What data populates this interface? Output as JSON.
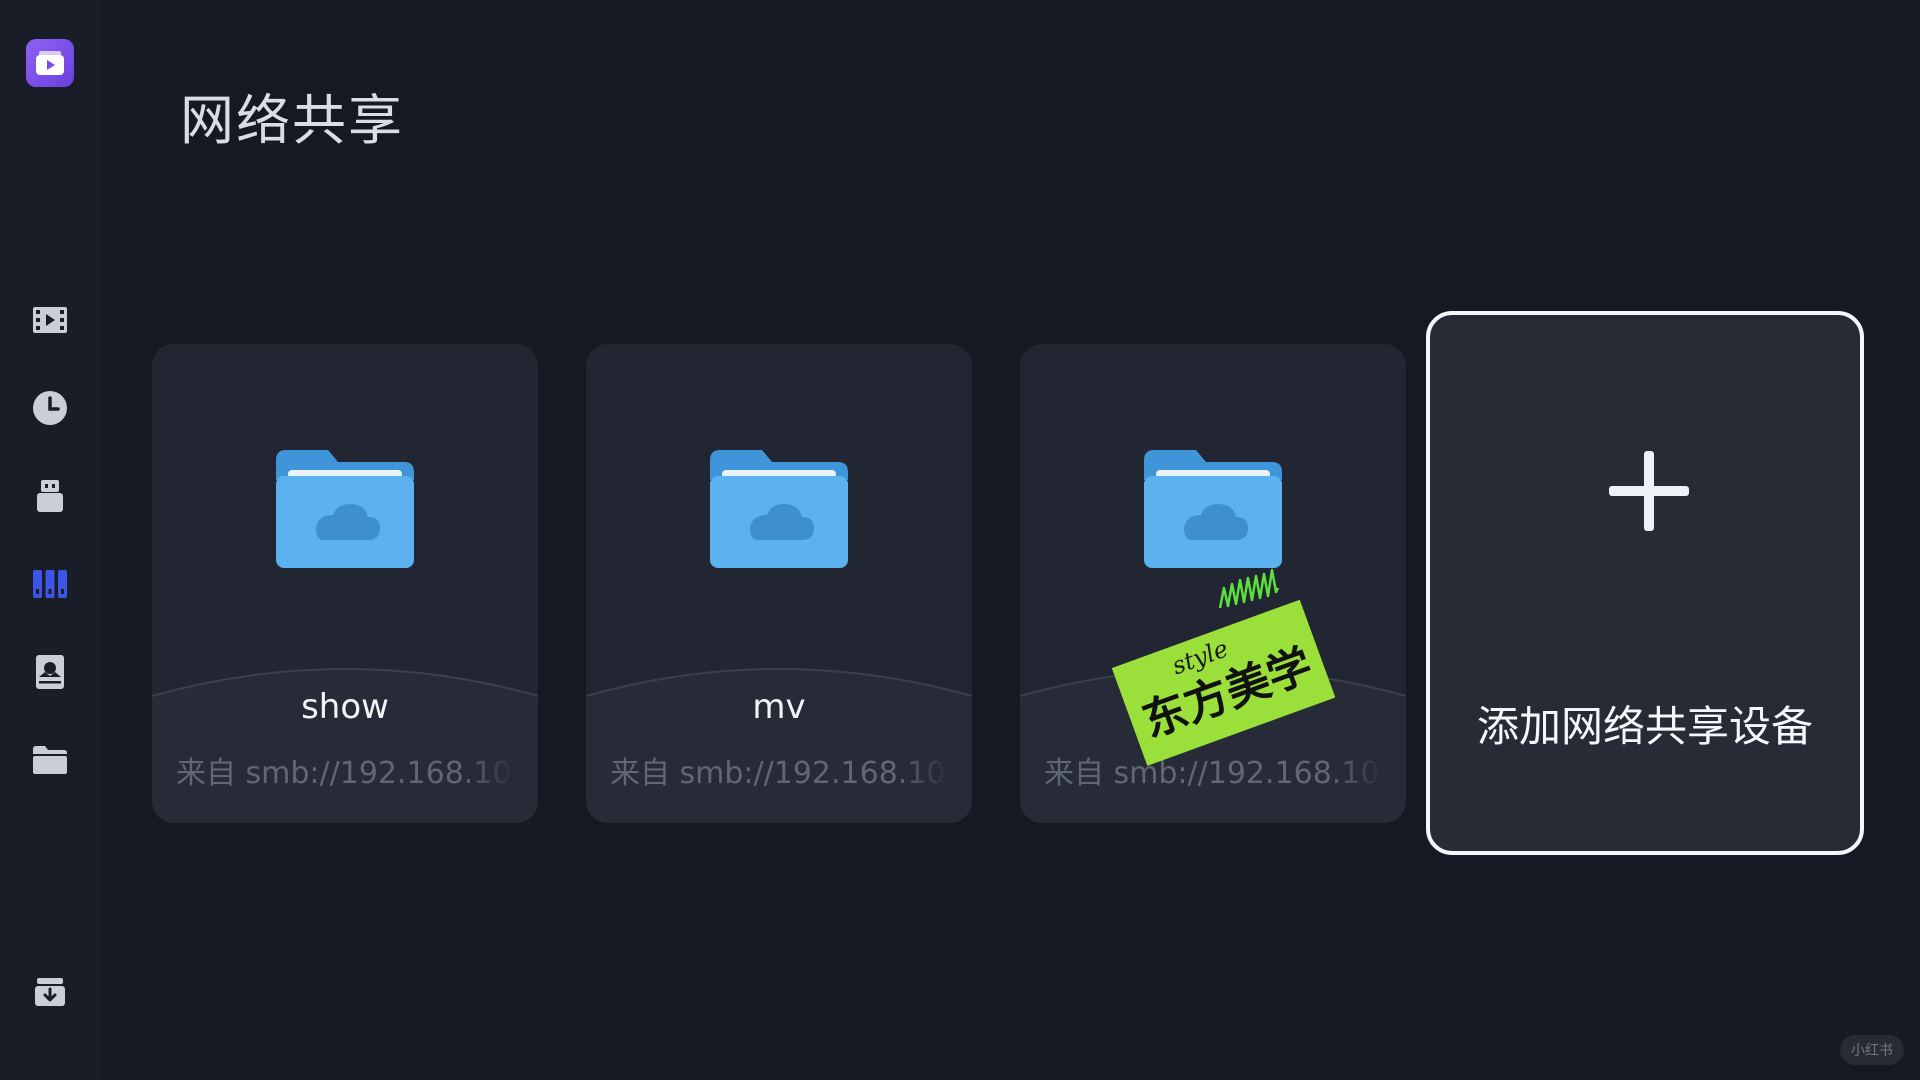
{
  "page": {
    "title": "网络共享"
  },
  "sidebar": {
    "items": [
      {
        "icon": "app-logo-icon"
      },
      {
        "icon": "film-icon"
      },
      {
        "icon": "history-clock-icon"
      },
      {
        "icon": "usb-icon"
      },
      {
        "icon": "library-icon",
        "active": true
      },
      {
        "icon": "nas-drive-icon"
      },
      {
        "icon": "folder-icon"
      },
      {
        "icon": "download-icon"
      }
    ],
    "active_color": "#3d55e6",
    "icon_color": "#c9ced8"
  },
  "shares": [
    {
      "name": "show",
      "source": "来自 smb://192.168.10"
    },
    {
      "name": "mv",
      "source": "来自 smb://192.168.10"
    },
    {
      "name": "",
      "source": "来自 smb://192.168.10"
    }
  ],
  "add_card": {
    "label": "添加网络共享设备"
  },
  "sticker": {
    "script_text": "style",
    "main_text": "东方美学"
  },
  "watermark": {
    "text": "小红书"
  },
  "colors": {
    "folder_blue": "#5bb2ee",
    "background": "#141923",
    "card": "#212632"
  }
}
